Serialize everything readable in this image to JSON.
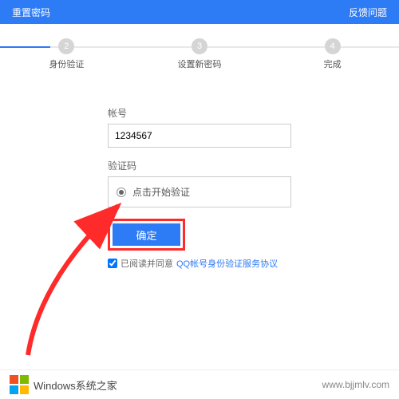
{
  "header": {
    "title": "重置密码",
    "feedback": "反馈问题"
  },
  "steps": [
    {
      "num": "2",
      "label": "身份验证"
    },
    {
      "num": "3",
      "label": "设置新密码"
    },
    {
      "num": "4",
      "label": "完成"
    }
  ],
  "form": {
    "account_label": "帐号",
    "account_value": "1234567",
    "captcha_label": "验证码",
    "captcha_text": "点击开始验证",
    "submit": "确定",
    "agree_prefix": "已阅读并同意",
    "agree_link": "QQ帐号身份验证服务协议"
  },
  "footer": {
    "brand": "Windows系统之家",
    "site": "www.bjjmlv.com"
  }
}
